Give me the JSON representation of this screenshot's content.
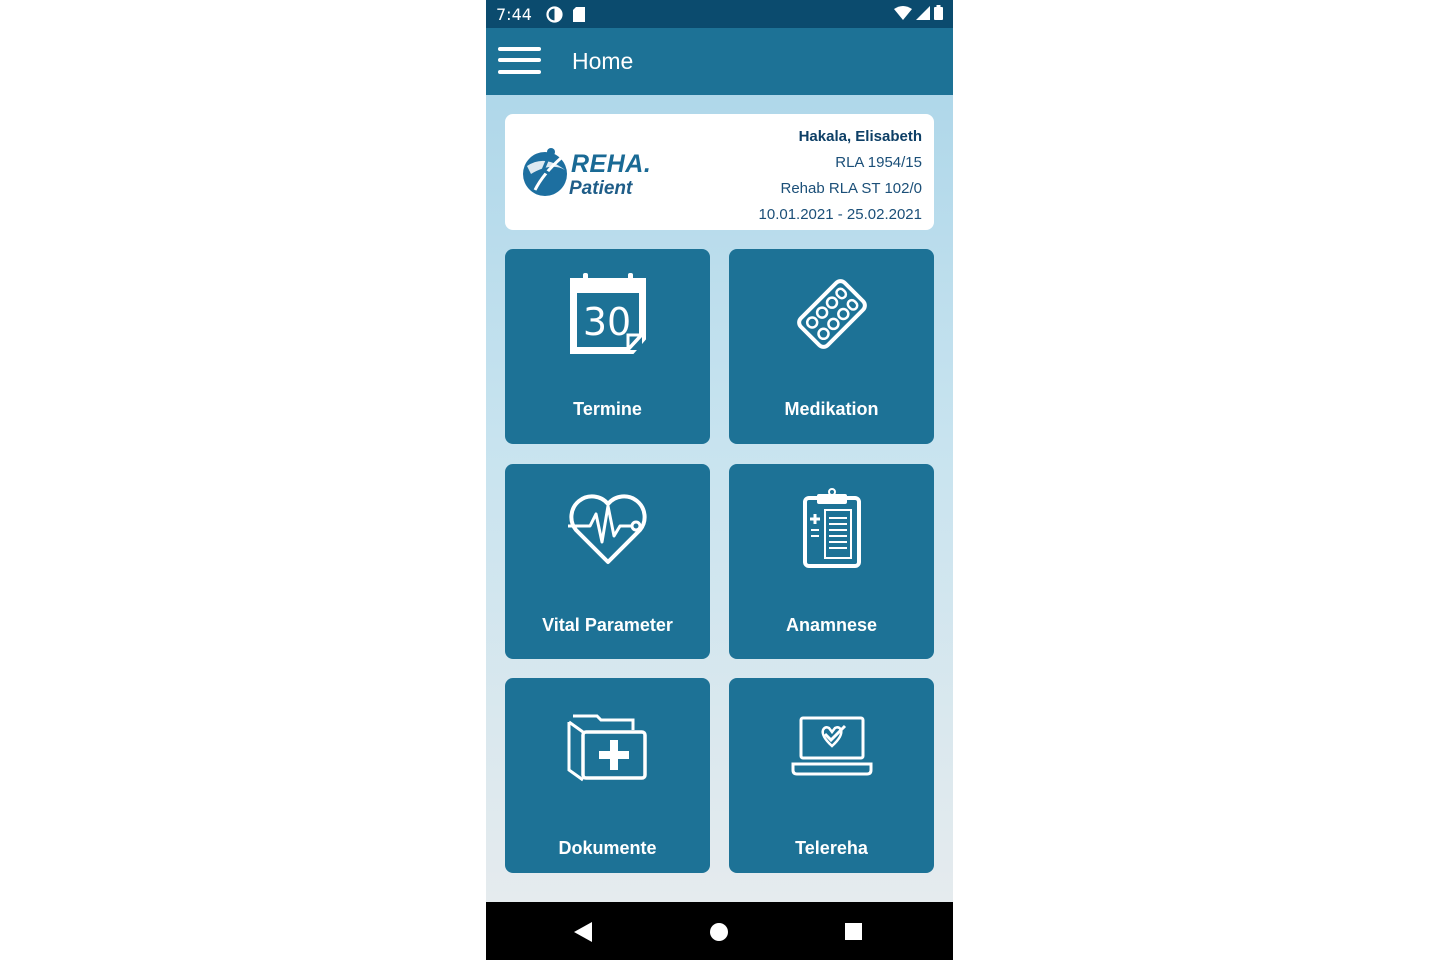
{
  "status_bar": {
    "time": "7:44",
    "left_icons": [
      "data-saver-icon",
      "sd-card-icon"
    ],
    "right_icons": [
      "wifi-icon",
      "signal-icon",
      "battery-icon"
    ]
  },
  "app_bar": {
    "title": "Home",
    "menu_icon": "hamburger-menu-icon"
  },
  "patient_card": {
    "logo": {
      "line1": "REHA.",
      "line2": "Patient"
    },
    "name": "Hakala, Elisabeth",
    "id": "RLA 1954/15",
    "station": "Rehab RLA ST 102/0",
    "period": "10.01.2021 - 25.02.2021"
  },
  "tiles": [
    {
      "label": "Termine",
      "icon": "calendar-icon",
      "calendar_day": "30"
    },
    {
      "label": "Medikation",
      "icon": "pill-blister-icon"
    },
    {
      "label": "Vital Parameter",
      "icon": "heart-pulse-icon"
    },
    {
      "label": "Anamnese",
      "icon": "clipboard-icon"
    },
    {
      "label": "Dokumente",
      "icon": "medical-folder-icon"
    },
    {
      "label": "Telereha",
      "icon": "laptop-check-icon"
    }
  ],
  "nav_bar": {
    "buttons": [
      "back-triangle-icon",
      "home-circle-icon",
      "recents-square-icon"
    ]
  },
  "colors": {
    "status_bar": "#0b4b6e",
    "app_bar": "#1d7296",
    "tile": "#1d7296",
    "card": "#ffffff",
    "text_dark": "#0d3f66"
  }
}
